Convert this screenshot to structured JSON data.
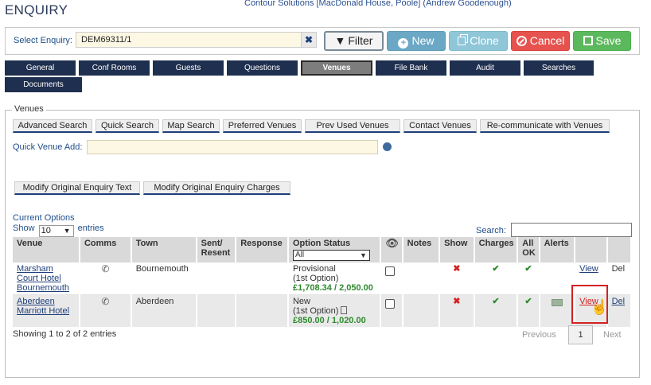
{
  "page_title": "ENQUIRY",
  "company_line": "Contour Solutions [MacDonald House, Poole] (Andrew Goodenough)",
  "enquiry": {
    "label": "Select Enquiry:",
    "value": "DEM69311/1",
    "clear_icon": "close-icon"
  },
  "toolbar": {
    "filter": "Filter",
    "new": "New",
    "clone": "Clone",
    "cancel": "Cancel",
    "save": "Save"
  },
  "tabs_row1": [
    "General",
    "Conf Rooms",
    "Guests",
    "Questions",
    "Venues",
    "File Bank",
    "Audit",
    "Searches"
  ],
  "tabs_row2": [
    "Documents"
  ],
  "active_tab": "Venues",
  "venues": {
    "legend": "Venues",
    "search_buttons": [
      "Advanced Search",
      "Quick Search",
      "Map Search",
      "Preferred Venues",
      "Prev Used Venues",
      "Contact Venues",
      "Re-communicate with Venues"
    ],
    "quick_add_label": "Quick Venue Add:",
    "quick_add_value": "",
    "modify_buttons": [
      "Modify Original Enquiry Text",
      "Modify Original Enquiry Charges"
    ]
  },
  "options": {
    "title": "Current Options",
    "show_prefix": "Show",
    "show_value": "10",
    "show_suffix": "entries",
    "search_label": "Search:",
    "search_value": "",
    "columns": [
      "Venue",
      "Comms",
      "Town",
      "Sent/ Resent",
      "Response",
      "Option Status",
      "",
      "Notes",
      "Show",
      "Charges",
      "All OK",
      "Alerts",
      "",
      ""
    ],
    "status_filter": "All",
    "rows": [
      {
        "venue": "Marsham Court Hotel Bournemouth",
        "town": "Bournemouth",
        "status": "Provisional",
        "option": "(1st Option)",
        "price": "£1,708.34 / 2,050.00",
        "view": "View",
        "del": "Del"
      },
      {
        "venue": "Aberdeen Marriott Hotel",
        "town": "Aberdeen",
        "status": "New",
        "option": "(1st Option)",
        "price": "£850.00 / 1,020.00",
        "view": "View",
        "del": "Del"
      }
    ],
    "footer": "Showing 1 to 2 of 2 entries",
    "pagination": {
      "previous": "Previous",
      "page": "1",
      "next": "Next"
    }
  }
}
